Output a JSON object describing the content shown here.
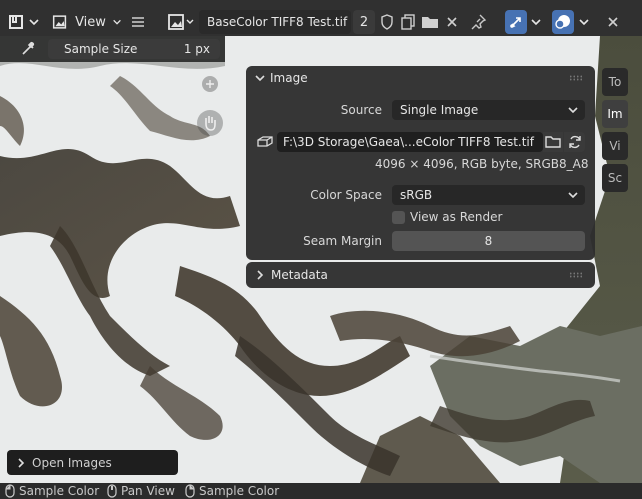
{
  "header": {
    "view_label": "View",
    "image_name": "BaseColor TIFF8 Test.tif",
    "user_count": "2"
  },
  "tool_settings": {
    "sample_size_label": "Sample Size",
    "sample_size_value": "1 px"
  },
  "image_panel": {
    "title": "Image",
    "source_label": "Source",
    "source_value": "Single Image",
    "filepath": "F:\\3D Storage\\Gaea\\...eColor TIFF8 Test.tif",
    "info": "4096 × 4096,  RGB byte, SRGB8_A8",
    "color_space_label": "Color Space",
    "color_space_value": "sRGB",
    "view_as_render_label": "View as Render",
    "view_as_render_checked": false,
    "seam_margin_label": "Seam Margin",
    "seam_margin_value": "8"
  },
  "metadata_panel": {
    "title": "Metadata"
  },
  "sidebar_tabs": [
    {
      "label": "To"
    },
    {
      "label": "Im"
    },
    {
      "label": "Vi"
    },
    {
      "label": "Sc"
    }
  ],
  "open_images_label": "Open Images",
  "statusbar": {
    "items": [
      {
        "label": "Sample Color"
      },
      {
        "label": "Pan View"
      },
      {
        "label": "Sample Color"
      }
    ]
  },
  "colors": {
    "accent_blue": "#4772b3",
    "header_bg": "#303030",
    "panel_bg": "#2e2e2e",
    "snow": "#e8eaea",
    "rock": "#4a4136"
  }
}
